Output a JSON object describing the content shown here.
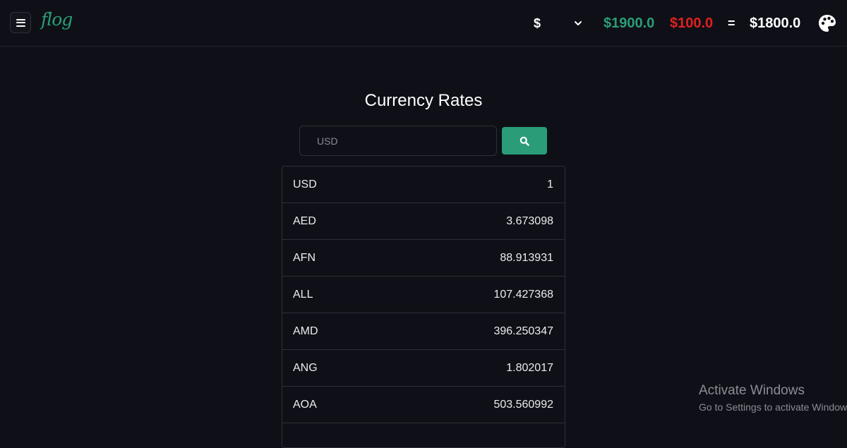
{
  "header": {
    "logo_text": "flog",
    "currency_symbol": "$",
    "income": "$1900.0",
    "expense": "$100.0",
    "equals": "=",
    "balance": "$1800.0"
  },
  "colors": {
    "accent": "#2a9d78",
    "expense": "#e0201e",
    "background": "#0f1017"
  },
  "icons": {
    "menu": "hamburger-menu-icon",
    "dropdown": "chevron-down-icon",
    "search": "search-icon",
    "theme": "palette-icon"
  },
  "main": {
    "title": "Currency Rates",
    "search_placeholder": "USD",
    "rates": [
      {
        "code": "USD",
        "rate": "1"
      },
      {
        "code": "AED",
        "rate": "3.673098"
      },
      {
        "code": "AFN",
        "rate": "88.913931"
      },
      {
        "code": "ALL",
        "rate": "107.427368"
      },
      {
        "code": "AMD",
        "rate": "396.250347"
      },
      {
        "code": "ANG",
        "rate": "1.802017"
      },
      {
        "code": "AOA",
        "rate": "503.560992"
      },
      {
        "code": "",
        "rate": ""
      }
    ]
  },
  "watermark": {
    "line1": "Activate Windows",
    "line2": "Go to Settings to activate Windows."
  }
}
